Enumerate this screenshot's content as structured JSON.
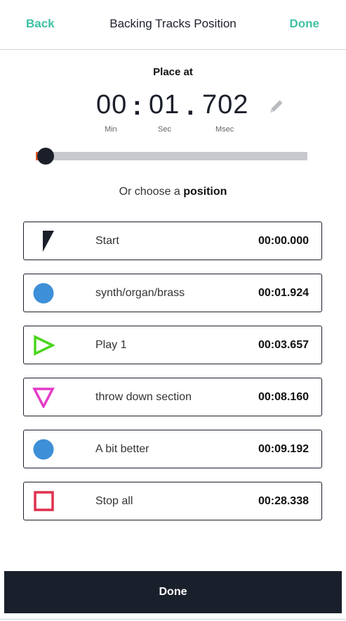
{
  "header": {
    "back_label": "Back",
    "title": "Backing Tracks Position",
    "done_label": "Done"
  },
  "place": {
    "label": "Place at",
    "min": "00",
    "sec": "01",
    "msec": "702",
    "sep1": ":",
    "sep2": ".",
    "min_unit": "Min",
    "sec_unit": "Sec",
    "msec_unit": "Msec",
    "edit_icon": "pencil-icon"
  },
  "slider": {
    "value_fraction": 0.06,
    "fill_color": "#e35d2c",
    "knob_color": "#1b1f2a"
  },
  "choose": {
    "prefix": "Or choose a ",
    "bold": "position"
  },
  "positions": [
    {
      "icon": "start-flag-icon",
      "label": "Start",
      "time": "00:00.000"
    },
    {
      "icon": "blue-circle-icon",
      "color": "#3d8fd8",
      "label": "synth/organ/brass",
      "time": "00:01.924"
    },
    {
      "icon": "play-triangle-icon",
      "color": "#4bd51e",
      "label": "Play 1",
      "time": "00:03.657"
    },
    {
      "icon": "down-triangle-icon",
      "color": "#e43bc7",
      "label": "throw down section",
      "time": "00:08.160"
    },
    {
      "icon": "blue-circle-icon",
      "color": "#3d8fd8",
      "label": "A bit better",
      "time": "00:09.192"
    },
    {
      "icon": "stop-square-icon",
      "color": "#e0304f",
      "label": "Stop all",
      "time": "00:28.338"
    }
  ],
  "footer": {
    "done_label": "Done"
  }
}
